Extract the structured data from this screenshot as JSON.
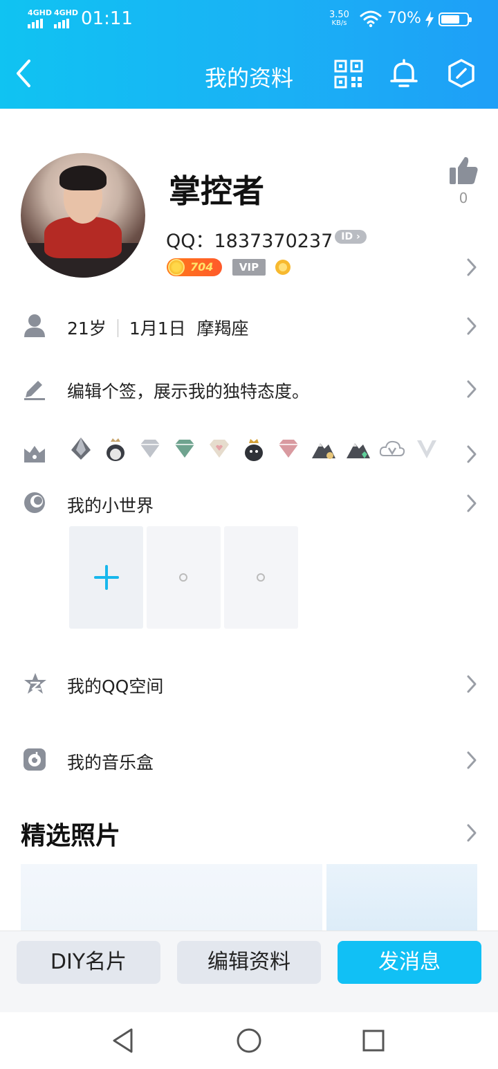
{
  "status_bar": {
    "signal1": "4GHD",
    "signal2": "4GHD",
    "time": "01:11",
    "speed_value": "3.50",
    "speed_unit": "KB/s",
    "battery_percent": "70%"
  },
  "nav": {
    "title": "我的资料",
    "back_icon": "chevron-left-icon",
    "qr_icon": "qr-code-icon",
    "bell_icon": "bell-icon",
    "settings_icon": "hexagon-icon"
  },
  "profile": {
    "nickname": "掌控者",
    "like_count": "0",
    "qq_label": "QQ：1837370237",
    "id_badge": "ID",
    "level": "704",
    "vip_label": "VIP"
  },
  "info_rows": {
    "age": "21岁",
    "birthday": "1月1日",
    "constellation": "摩羯座",
    "signature": "编辑个签，展示我的独特态度。",
    "small_world": "我的小世界",
    "qzone": "我的QQ空间",
    "music_box": "我的音乐盒"
  },
  "featured_photos": {
    "title": "精选照片"
  },
  "actions": {
    "diy_card": "DIY名片",
    "edit_profile": "编辑资料",
    "send_message": "发消息"
  },
  "colors": {
    "header_start": "#10c3f2",
    "header_end": "#1e9ff7",
    "accent": "#11c0f5"
  }
}
